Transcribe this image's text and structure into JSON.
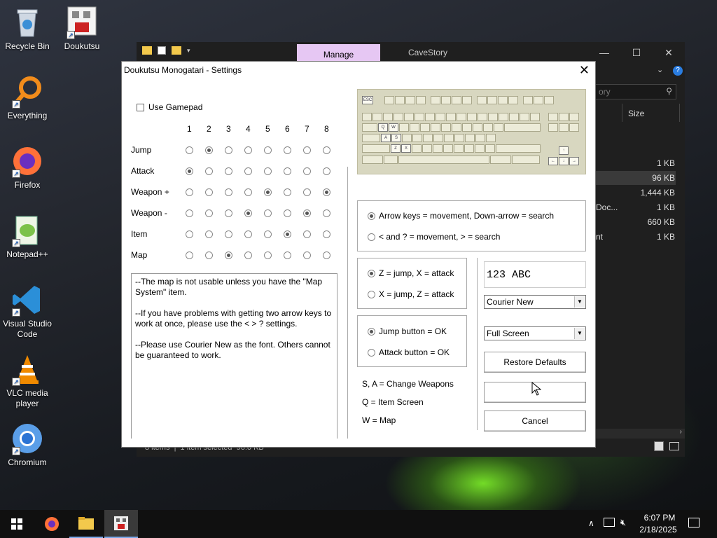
{
  "desktop": {
    "icons": [
      {
        "label": "Recycle Bin"
      },
      {
        "label": "Doukutsu"
      },
      {
        "label": "Everything"
      },
      {
        "label": "Firefox"
      },
      {
        "label": "Notepad++"
      },
      {
        "label": "Visual Studio Code"
      },
      {
        "label": "VLC media player"
      },
      {
        "label": "Chromium"
      }
    ]
  },
  "explorer": {
    "manage_tab": "Manage",
    "title": "CaveStory",
    "search_placeholder": "ory",
    "col_size": "Size",
    "sizes": [
      "1 KB",
      "96 KB",
      "1,444 KB",
      "1 KB",
      "660 KB",
      "1 KB"
    ],
    "partial_names": [
      "Doc...",
      "nt"
    ],
    "status": "8 items  |  1 item selected  96.0 KB"
  },
  "dialog": {
    "title": "Doukutsu Monogatari - Settings",
    "use_gamepad": "Use Gamepad",
    "columns": [
      "1",
      "2",
      "3",
      "4",
      "5",
      "6",
      "7",
      "8"
    ],
    "rows": [
      {
        "label": "Jump",
        "selected": 2
      },
      {
        "label": "Attack",
        "selected": 1
      },
      {
        "label": "Weapon +",
        "selected": [
          5,
          8
        ]
      },
      {
        "label": "Weapon -",
        "selected": [
          4,
          7
        ]
      },
      {
        "label": "Item",
        "selected": 6
      },
      {
        "label": "Map",
        "selected": 3
      }
    ],
    "note": "--The map is not usable unless you have the \"Map System\" item.\n\n--If you have problems with getting two arrow keys to work at once, please use the < > ? settings.\n\n--Please use Courier New as the font. Others cannot be guaranteed to work.",
    "movement": {
      "opt1": "Arrow keys = movement, Down-arrow = search",
      "opt2": "< and ? = movement, > = search",
      "selected": 1
    },
    "jump_attack": {
      "opt1": "Z = jump, X = attack",
      "opt2": "X = jump, Z = attack",
      "selected": 1
    },
    "ok_button_mode": {
      "opt1": "Jump button = OK",
      "opt2": "Attack button = OK",
      "selected": 1
    },
    "hints": [
      "S, A = Change Weapons",
      "Q = Item Screen",
      "W = Map"
    ],
    "font_preview": "123 ABC",
    "font_value": "Courier New",
    "display_value": "Full Screen",
    "restore_label": "Restore Defaults",
    "ok_label": "",
    "cancel_label": "Cancel",
    "keyboard_keys": {
      "esc": "ESC",
      "q": "Q",
      "w": "W",
      "a": "A",
      "s": "S",
      "z": "Z",
      "x": "X",
      "up": "↑",
      "left": "←",
      "down": "↓",
      "right": "→"
    }
  },
  "taskbar": {
    "time": "6:07 PM",
    "date": "2/18/2025"
  }
}
